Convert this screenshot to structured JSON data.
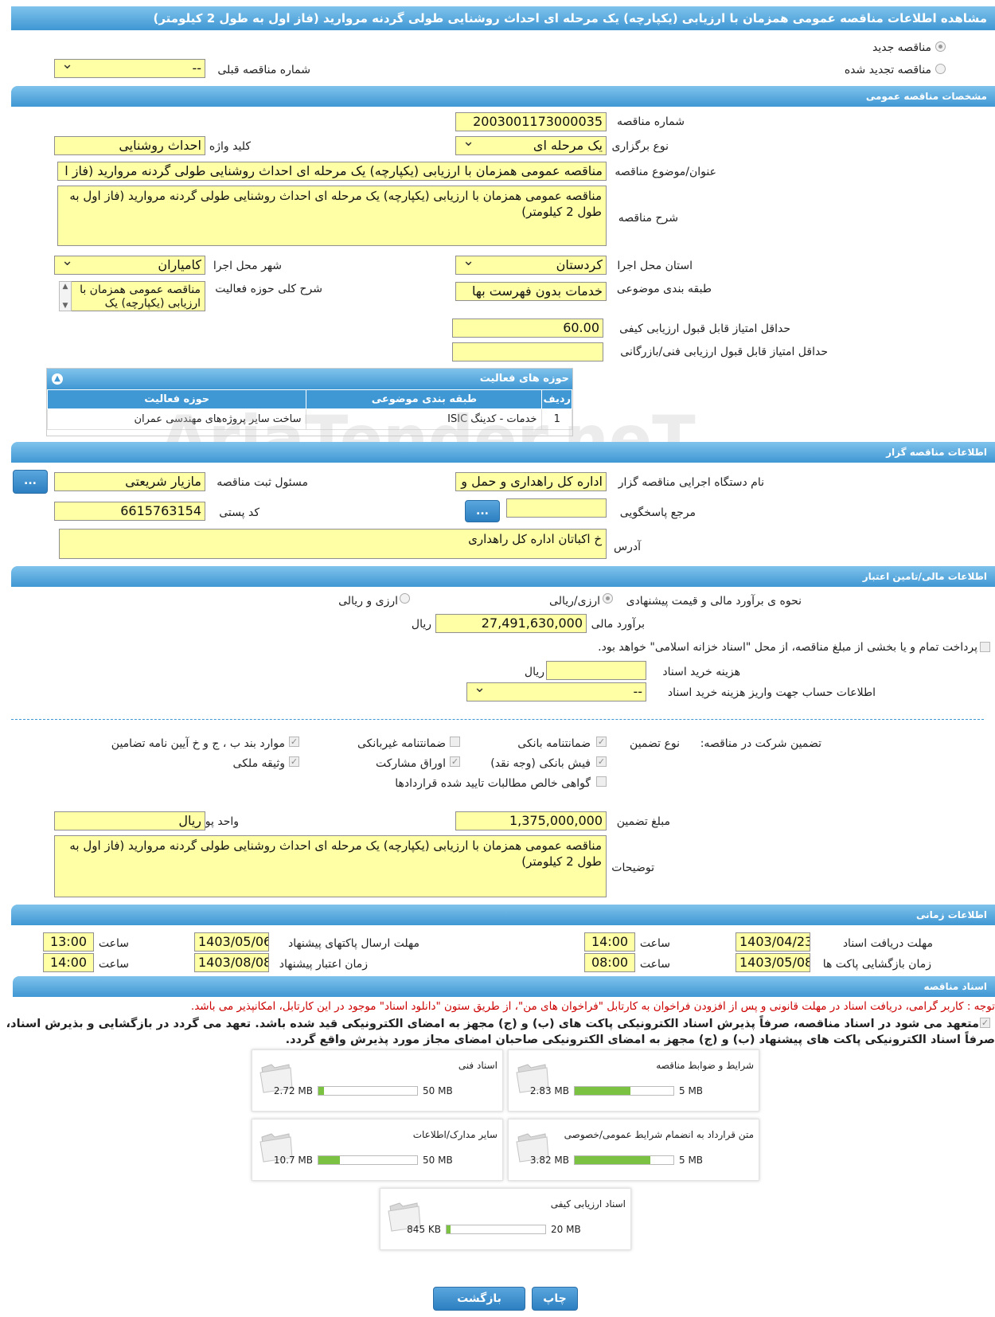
{
  "page_title": "مشاهده اطلاعات مناقصه عمومی همزمان با ارزیابی (یکپارچه) یک مرحله ای احداث روشنایی طولی گردنه مروارید (فاز اول به طول 2 کیلومتر)",
  "top": {
    "new_tender": "مناقصه جدید",
    "renewed_tender": "مناقصه تجدید شده",
    "prev_number_label": "شماره مناقصه قبلی",
    "prev_number_value": "--"
  },
  "general": {
    "section": "مشخصات مناقصه عمومی",
    "number_label": "شماره مناقصه",
    "number_value": "2003001173000035",
    "type_label": "نوع برگزاری",
    "type_value": "یک مرحله ای",
    "keyword_label": "کلید واژه",
    "keyword_value": "احداث روشنایی",
    "subject_label": "عنوان/موضوع مناقصه",
    "subject_value": "مناقصه عمومی همزمان با ارزیابی (یکپارچه) یک مرحله ای احداث روشنایی طولی گردنه مروارید (فاز ا",
    "desc_label": "شرح مناقصه",
    "desc_value": "مناقصه عمومی همزمان با ارزیابی (یکپارچه) یک مرحله ای احداث روشنایی طولی گردنه مروارید (فاز اول به طول 2 کیلومتر)",
    "province_label": "استان محل اجرا",
    "province_value": "کردستان",
    "city_label": "شهر محل اجرا",
    "city_value": "کامیاران",
    "category_label": "طبقه بندی موضوعی",
    "category_value": "خدمات بدون فهرست بها",
    "activity_label": "شرح کلی حوزه فعالیت",
    "activity_value": "مناقصه عمومی همزمان با ارزیابی (یکپارچه) یک",
    "min_quality_label": "حداقل امتیاز قابل قبول ارزیابی کیفی",
    "min_quality_value": "60.00",
    "min_tech_label": "حداقل امتیاز قابل قبول ارزیابی فنی/بازرگانی",
    "min_tech_value": ""
  },
  "activity_table": {
    "title": "حوزه های فعالیت",
    "headers": [
      "ردیف",
      "طبقه بندی موضوعی",
      "حوزه فعالیت"
    ],
    "rows": [
      [
        "1",
        "خدمات - کدینگ ISIC",
        "ساخت سایر پروژه‌های مهندسی عمران"
      ]
    ]
  },
  "organizer": {
    "section": "اطلاعات مناقصه گزار",
    "org_label": "نام دستگاه اجرایی مناقصه گزار",
    "org_value": "اداره کل راهداری و حمل و نقل",
    "registrar_label": "مسئول ثبت مناقصه",
    "registrar_value": "مازیار شریعتی",
    "ref_label": "مرجع پاسخگویی",
    "ref_value": "",
    "postal_label": "کد پستی",
    "postal_value": "6615763154",
    "address_label": "آدرس",
    "address_value": "خ اکباتان اداره کل راهداری",
    "dots": "..."
  },
  "finance": {
    "section": "اطلاعات مالی/تامین اعتبار",
    "method_label": "نحوه ی برآورد مالی و قیمت پیشنهادی",
    "opt_rial": "ارزی/ریالی",
    "opt_currency": "ارزی و ریالی",
    "estimate_label": "برآورد مالی",
    "estimate_value": "27,491,630,000",
    "estimate_unit": "ریال",
    "treasury_note": "پرداخت تمام و یا بخشی از مبلغ مناقصه، از محل \"اسناد خزانه اسلامی\" خواهد بود.",
    "doc_fee_label": "هزینه خرید اسناد",
    "doc_fee_value": "",
    "doc_fee_unit": "ریال",
    "account_label": "اطلاعات حساب جهت واریز هزینه خرید اسناد",
    "account_value": "--"
  },
  "guarantee": {
    "title": "تضمین شرکت در مناقصه:",
    "type_label": "نوع تضمین",
    "options": {
      "bank_guarantee": "ضمانتنامه بانکی",
      "non_bank_guarantee": "ضمانتنامه غیربانکی",
      "clauses": "موارد بند ب ، ج و خ آیین نامه تضامین",
      "bank_receipt": "فیش بانکی (وجه نقد)",
      "participation_bonds": "اوراق مشارکت",
      "property_collateral": "وثیقه ملکی",
      "net_claims": "گواهی خالص مطالبات تایید شده قراردادها"
    },
    "amount_label": "مبلغ تضمین",
    "amount_value": "1,375,000,000",
    "currency_label": "واحد پول",
    "currency_value": "ریال",
    "notes_label": "توضیحات",
    "notes_value": "مناقصه عمومی همزمان با ارزیابی (یکپارچه) یک مرحله ای احداث روشنایی طولی گردنه مروارید (فاز اول به طول 2 کیلومتر)"
  },
  "timing": {
    "section": "اطلاعات زمانی",
    "doc_deadline_label": "مهلت دریافت اسناد",
    "doc_deadline_date": "1403/04/23",
    "doc_deadline_time": "14:00",
    "submit_deadline_label": "مهلت ارسال پاکتهای پیشنهاد",
    "submit_deadline_date": "1403/05/06",
    "submit_deadline_time": "13:00",
    "opening_label": "زمان بازگشایی پاکت ها",
    "opening_date": "1403/05/08",
    "opening_time": "08:00",
    "validity_label": "زمان اعتبار پیشنهاد",
    "validity_date": "1403/08/08",
    "validity_time": "14:00",
    "time_label": "ساعت"
  },
  "documents": {
    "section": "اسناد مناقصه",
    "notice": "توجه : کاربر گرامی، دریافت اسناد در مهلت قانونی و پس از افزودن فراخوان به کارتابل \"فراخوان های من\"، از طریق ستون \"دانلود اسناد\" موجود در این کارتابل، امکانپذیر می باشد.",
    "commitment": "متعهد می شود در اسناد مناقصه، صرفاً پذیرش اسناد الکترونیکی پاکت های (ب) و (ج) مجهز به امضای الکترونیکی قید شده باشد. تعهد می گردد در بازگشایی و بذیرش اسناد، صرفاً اسناد الکترونیکی پاکت های پیشنهاد (ب) و (ج) مجهز به امضای الکترونیکی صاحبان امضای مجاز مورد پذیرش واقع گردد.",
    "items": [
      {
        "name": "شرایط و ضوابط مناقصه",
        "used": "2.83 MB",
        "max": "5 MB",
        "ratio": 0.566
      },
      {
        "name": "اسناد فنی",
        "used": "2.72 MB",
        "max": "50 MB",
        "ratio": 0.054
      },
      {
        "name": "متن قرارداد به انضمام شرایط عمومی/خصوصی",
        "used": "3.82 MB",
        "max": "5 MB",
        "ratio": 0.764
      },
      {
        "name": "سایر مدارک/اطلاعات",
        "used": "10.7 MB",
        "max": "50 MB",
        "ratio": 0.214
      },
      {
        "name": "اسناد ارزیابی کیفی",
        "used": "845 KB",
        "max": "20 MB",
        "ratio": 0.041
      }
    ]
  },
  "buttons": {
    "print": "چاپ",
    "back": "بازگشت"
  },
  "watermark": "AriaTender.neT",
  "colors": {
    "header": "#3f97d3",
    "field": "#ffffa6",
    "progress": "#7cc242",
    "notice": "#cc0000"
  }
}
